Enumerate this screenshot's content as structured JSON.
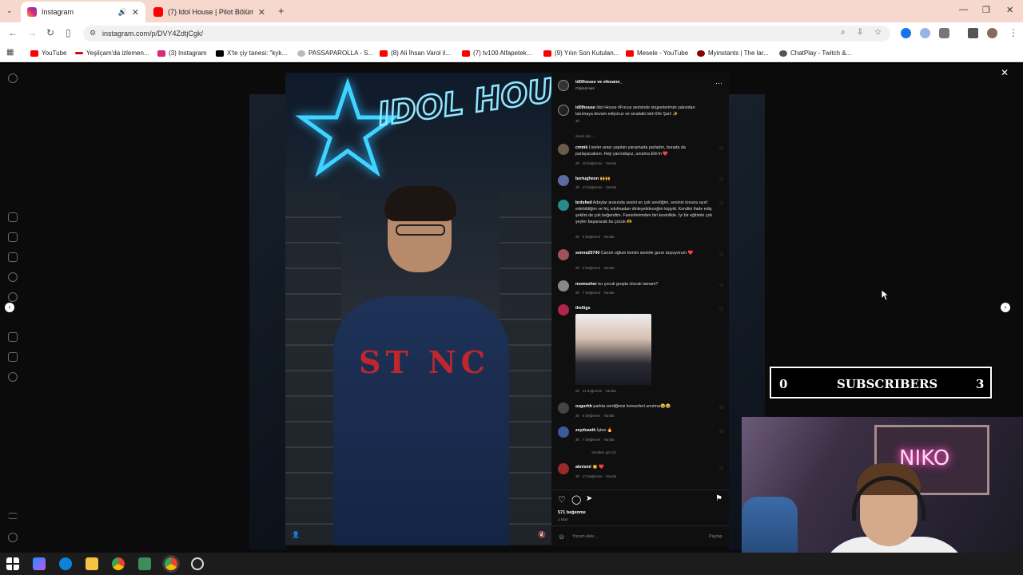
{
  "browser": {
    "tabs": [
      {
        "title": "Instagram",
        "active": true
      },
      {
        "title": "(7) Idol House | Pilot Bölüm - Yo",
        "active": false
      }
    ],
    "url": "instagram.com/p/DVY4ZdtjCgk/",
    "bookmarks": [
      "YouTube",
      "Yeşilçam'da izlemen...",
      "(3) Instagram",
      "X'te çiy tanesi: \"kyk...",
      "PASSAPAROLLA - S...",
      "(8) Ali İhsan Varol il...",
      "(7) tv100 Alfapetek...",
      "(9) Yılın Son Kutulan...",
      "Mesele - YouTube",
      "Myinstants | The lar...",
      "ChatPlay - Twitch &..."
    ]
  },
  "post": {
    "author": "id0lhouse ve efesann_",
    "audio": "Orijinal ses",
    "caption_user": "id0lhouse",
    "caption_text": "Idol House #Focus serisinde stajyerlerimizi yakından tanımaya devam ediyoruz ve sıradaki isim Efe Şan! ✨",
    "caption_time": "3h",
    "sort_label": "Senin için ⌄",
    "likes": "571 beğenme",
    "date": "2 Mart",
    "comment_placeholder": "Yorum ekle...",
    "share_label": "Paylaş",
    "replies_label": "Yanıtları gör (2)"
  },
  "comments": [
    {
      "user": "cmmk",
      "text": "Liseler arası yapılan yarışmada parladın, burada da parlayacaksın. Hep yanındayız, unutma Efe'm ❤️",
      "time": "2h",
      "likes": "18 beğenme",
      "reply": "Yanıtla"
    },
    {
      "user": "bertugheon",
      "text": "🙌🙌",
      "time": "3h",
      "likes": "17 beğenme",
      "reply": "Yanıtla"
    },
    {
      "user": "brdsfwd",
      "text": "Adaylar arasında sesini en çok sevdiğim, sesinin tonunu ayırt edebildiğim ve hiç sıkılmadan dinleyebileceğim kişiydi. Kendini ifade ediş şeklini de çok beğendim. Favorilerimden biri kesinlikle. İyi bir eğitimle çok şeyler başaracak bu çocuk 🫶",
      "time": "2h",
      "likes": "3 beğenme",
      "reply": "Yanıtla"
    },
    {
      "user": "semra20740",
      "text": "Canım oğlum benim seninle gurur duyuyorum ❤️",
      "time": "2h",
      "likes": "2 beğenme",
      "reply": "Yanıtla"
    },
    {
      "user": "momozher",
      "text": "bu çocuk grupta olucak tamam?",
      "time": "3h",
      "likes": "7 beğenme",
      "reply": "Yanıtla"
    },
    {
      "user": "thelligs",
      "text": "",
      "time": "2h",
      "likes": "11 beğenme",
      "reply": "Yanıtla"
    },
    {
      "user": "ozgurhh",
      "text": "parkta verdiğimiz konserleri unutma😂😂",
      "time": "3h",
      "likes": "6 beğenme",
      "reply": "Yanıtla"
    },
    {
      "user": "zeydsanik",
      "text": "İştee 🔥",
      "time": "3h",
      "likes": "7 beğenme",
      "reply": "Yanıtla"
    },
    {
      "user": "aknisml",
      "text": "👏 ❤️",
      "time": "3h",
      "likes": "17 beğenme",
      "reply": "Yanıtla"
    }
  ],
  "overlay": {
    "sub_left": "0",
    "sub_label": "SUBSCRIBERS",
    "sub_right": "3",
    "sign": "NIKO"
  },
  "video_sign": "IDOL HOUSE",
  "jacket": "ST NC"
}
